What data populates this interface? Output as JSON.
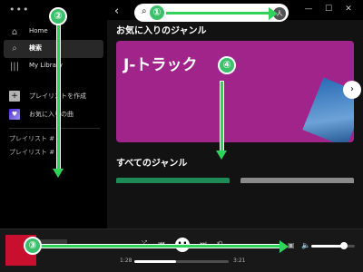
{
  "sidebar": {
    "home_label": "Home",
    "search_label": "検索",
    "library_label": "My Library",
    "create_playlist_label": "プレイリストを作成",
    "liked_songs_label": "お気に入りの曲",
    "playlists": [
      "プレイリスト #",
      "プレイリスト #"
    ]
  },
  "main": {
    "section_favorite_genres": "お気に入りのジャンル",
    "featured_card_title": "J-トラック",
    "section_all_genres": "すべてのジャンル"
  },
  "player": {
    "elapsed_time": "1:28",
    "total_time": "3:21",
    "progress": 0.44,
    "volume": 0.75
  },
  "annotations": [
    "①",
    "②",
    "③",
    "④"
  ],
  "colors": {
    "accent_green": "#2fd35a",
    "card_magenta": "#a1248a",
    "album_red": "#c8102e"
  }
}
